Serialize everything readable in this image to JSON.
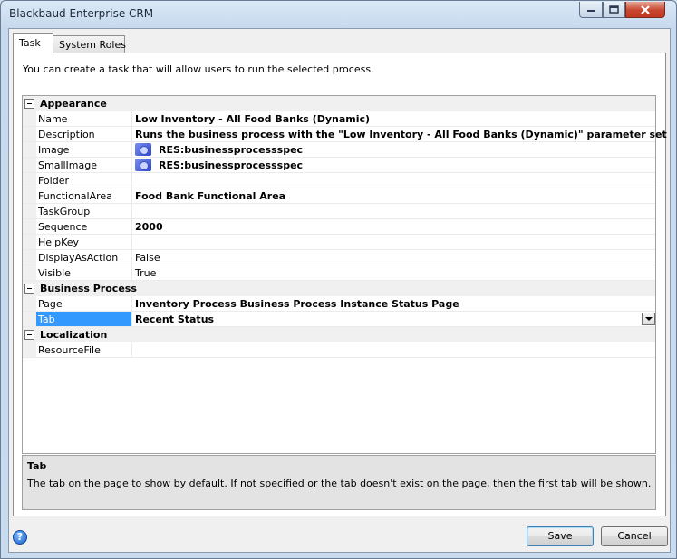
{
  "window": {
    "title": "Blackbaud Enterprise CRM"
  },
  "tabs": [
    {
      "label": "Task"
    },
    {
      "label": "System Roles"
    }
  ],
  "intro": "You can create a task that will allow users to run the selected process.",
  "grid": {
    "categories": {
      "appearance": "Appearance",
      "business_process": "Business Process",
      "localization": "Localization"
    },
    "appearance": [
      {
        "name": "Name",
        "value": "Low Inventory  - All Food Banks (Dynamic)"
      },
      {
        "name": "Description",
        "value": "Runs the business process with the \"Low Inventory - All Food Banks (Dynamic)\" parameter set"
      },
      {
        "name": "Image",
        "value": "RES:businessprocessspec"
      },
      {
        "name": "SmallImage",
        "value": "RES:businessprocessspec"
      },
      {
        "name": "Folder",
        "value": ""
      },
      {
        "name": "FunctionalArea",
        "value": "Food Bank Functional Area"
      },
      {
        "name": "TaskGroup",
        "value": ""
      },
      {
        "name": "Sequence",
        "value": "2000"
      },
      {
        "name": "HelpKey",
        "value": ""
      },
      {
        "name": "DisplayAsAction",
        "value": "False"
      },
      {
        "name": "Visible",
        "value": "True"
      }
    ],
    "business_process": [
      {
        "name": "Page",
        "value": "Inventory Process Business Process Instance Status Page"
      },
      {
        "name": "Tab",
        "value": "Recent Status"
      }
    ],
    "localization": [
      {
        "name": "ResourceFile",
        "value": ""
      }
    ]
  },
  "help": {
    "title": "Tab",
    "description": "The tab on the page to show by default.  If not specified or the tab doesn't exist on the page, then the first tab will be shown."
  },
  "buttons": {
    "save": "Save",
    "cancel": "Cancel",
    "help_glyph": "?"
  },
  "icons": {
    "minimize": "minimize-icon",
    "maximize": "maximize-icon",
    "close": "close-icon",
    "help": "help-icon",
    "process_image": "business-process-icon",
    "collapse": "collapse-icon",
    "dropdown": "dropdown-arrow-icon"
  },
  "colors": {
    "selection": "#3399ff",
    "close_button": "#c8462f"
  }
}
